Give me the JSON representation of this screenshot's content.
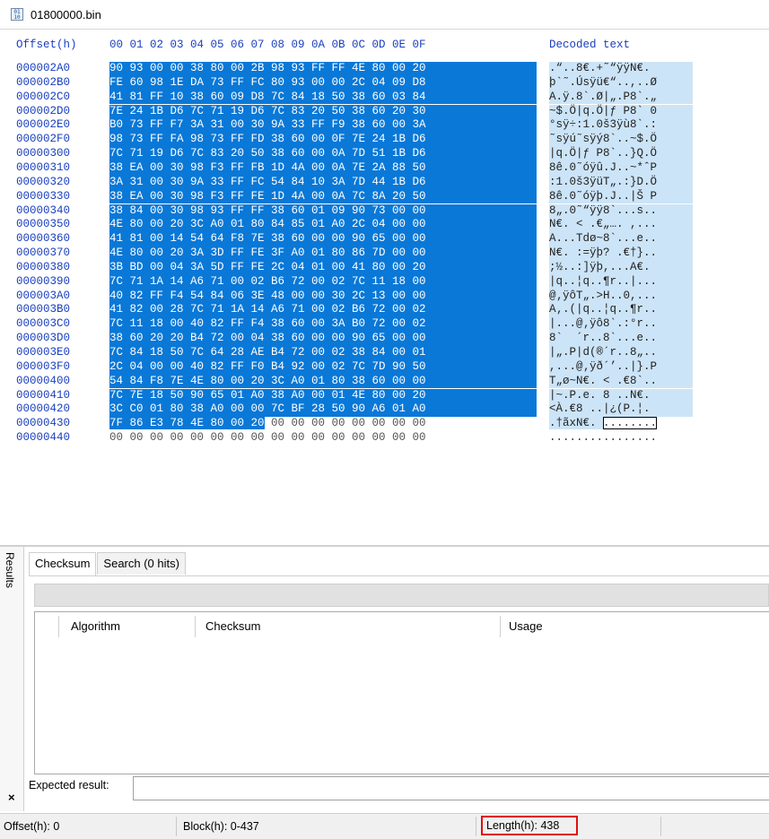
{
  "file_tab": {
    "title": "01800000.bin",
    "icon": "binary-file-icon",
    "icon_text": "01\n10"
  },
  "hex_header": {
    "offset_label": "Offset(h)",
    "columns": "00 01 02 03 04 05 06 07 08 09 0A 0B 0C 0D 0E 0F",
    "decoded_label": "Decoded text"
  },
  "rows": [
    {
      "offset": "000002A0",
      "hex": "90 93 00 00 38 80 00 2B 98 93 FF FF 4E 80 00 20",
      "dec": ".“..8€.+˜“ÿÿN€. "
    },
    {
      "offset": "000002B0",
      "hex": "FE 60 98 1E DA 73 FF FC 80 93 00 00 2C 04 09 D8",
      "dec": "þ`˜.Úsÿü€“..,..Ø"
    },
    {
      "offset": "000002C0",
      "hex": "41 81 FF 10 38 60 09 D8 7C 84 18 50 38 60 03 84",
      "dec": "A.ÿ.8`.Ø|„.P8`.„"
    },
    {
      "offset": "000002D0",
      "hex": "7E 24 1B D6 7C 71 19 D6 7C 83 20 50 38 60 20 30",
      "dec": "~$.Ö|q.Ö|ƒ P8` 0"
    },
    {
      "offset": "000002E0",
      "hex": "B0 73 FF F7 3A 31 00 30 9A 33 FF F9 38 60 00 3A",
      "dec": "°sÿ÷:1.0š3ÿù8`.:"
    },
    {
      "offset": "000002F0",
      "hex": "98 73 FF FA 98 73 FF FD 38 60 00 0F 7E 24 1B D6",
      "dec": "˜sÿú˜sÿý8`..~$.Ö"
    },
    {
      "offset": "00000300",
      "hex": "7C 71 19 D6 7C 83 20 50 38 60 00 0A 7D 51 1B D6",
      "dec": "|q.Ö|ƒ P8`..}Q.Ö"
    },
    {
      "offset": "00000310",
      "hex": "38 EA 00 30 98 F3 FF FB 1D 4A 00 0A 7E 2A 88 50",
      "dec": "8ê.0˜óÿû.J..~*ˆP"
    },
    {
      "offset": "00000320",
      "hex": "3A 31 00 30 9A 33 FF FC 54 84 10 3A 7D 44 1B D6",
      "dec": ":1.0š3ÿüT„.:}D.Ö"
    },
    {
      "offset": "00000330",
      "hex": "38 EA 00 30 98 F3 FF FE 1D 4A 00 0A 7C 8A 20 50",
      "dec": "8ê.0˜óÿþ.J..|Š P"
    },
    {
      "offset": "00000340",
      "hex": "38 84 00 30 98 93 FF FF 38 60 01 09 90 73 00 00",
      "dec": "8„.0˜“ÿÿ8`...s.."
    },
    {
      "offset": "00000350",
      "hex": "4E 80 00 20 3C A0 01 80 84 85 01 A0 2C 04 00 00",
      "dec": "N€. < .€„…. ,..."
    },
    {
      "offset": "00000360",
      "hex": "41 81 00 14 54 64 F8 7E 38 60 00 00 90 65 00 00",
      "dec": "A...Tdø~8`...e.."
    },
    {
      "offset": "00000370",
      "hex": "4E 80 00 20 3A 3D FF FE 3F A0 01 80 86 7D 00 00",
      "dec": "N€. :=ÿþ? .€†}.."
    },
    {
      "offset": "00000380",
      "hex": "3B BD 00 04 3A 5D FF FE 2C 04 01 00 41 80 00 20",
      "dec": ";½..:]ÿþ,...A€. "
    },
    {
      "offset": "00000390",
      "hex": "7C 71 1A 14 A6 71 00 02 B6 72 00 02 7C 11 18 00",
      "dec": "|q..¦q..¶r..|..."
    },
    {
      "offset": "000003A0",
      "hex": "40 82 FF F4 54 84 06 3E 48 00 00 30 2C 13 00 00",
      "dec": "@‚ÿôT„.>H..0,..."
    },
    {
      "offset": "000003B0",
      "hex": "41 82 00 28 7C 71 1A 14 A6 71 00 02 B6 72 00 02",
      "dec": "A‚.(|q..¦q..¶r.."
    },
    {
      "offset": "000003C0",
      "hex": "7C 11 18 00 40 82 FF F4 38 60 00 3A B0 72 00 02",
      "dec": "|...@‚ÿô8`.:°r.."
    },
    {
      "offset": "000003D0",
      "hex": "38 60 20 20 B4 72 00 04 38 60 00 00 90 65 00 00",
      "dec": "8`  ´r..8`...e.."
    },
    {
      "offset": "000003E0",
      "hex": "7C 84 18 50 7C 64 28 AE B4 72 00 02 38 84 00 01",
      "dec": "|„.P|d(®´r..8„.."
    },
    {
      "offset": "000003F0",
      "hex": "2C 04 00 00 40 82 FF F0 B4 92 00 02 7C 7D 90 50",
      "dec": ",...@‚ÿð´’..|}.P"
    },
    {
      "offset": "00000400",
      "hex": "54 84 F8 7E 4E 80 00 20 3C A0 01 80 38 60 00 00",
      "dec": "T„ø~N€. < .€8`.."
    },
    {
      "offset": "00000410",
      "hex": "7C 7E 18 50 90 65 01 A0 38 A0 00 01 4E 80 00 20",
      "dec": "|~.P.e. 8 ..N€. "
    },
    {
      "offset": "00000420",
      "hex": "3C C0 01 80 38 A0 00 00 7C BF 28 50 90 A6 01 A0",
      "dec": "<À.€8 ..|¿(P.¦. "
    },
    {
      "offset": "00000430",
      "hex_sel": "7F 86 E3 78 4E 80 00 20",
      "hex_rest": " 00 00 00 00 00 00 00 00",
      "dec_sel": ".†ãxN€. ",
      "dec_rest": "........"
    },
    {
      "offset": "00000440",
      "hex": "00 00 00 00 00 00 00 00 00 00 00 00 00 00 00 00",
      "dec": "................"
    }
  ],
  "results": {
    "side_label": "Results",
    "close_icon": "×",
    "tabs": [
      {
        "label": "Checksum"
      },
      {
        "label": "Search (0 hits)"
      }
    ],
    "columns": {
      "algorithm": "Algorithm",
      "checksum": "Checksum",
      "usage": "Usage"
    },
    "expected_label": "Expected result:"
  },
  "status": {
    "offset": "Offset(h): 0",
    "block": "Block(h): 0-437",
    "length": "Length(h): 438",
    "highlight_color": "#e01010"
  },
  "colors": {
    "selection": "#0a78d7",
    "decoded_selection": "#cce4f7",
    "offset_text": "#1a3fbf"
  }
}
